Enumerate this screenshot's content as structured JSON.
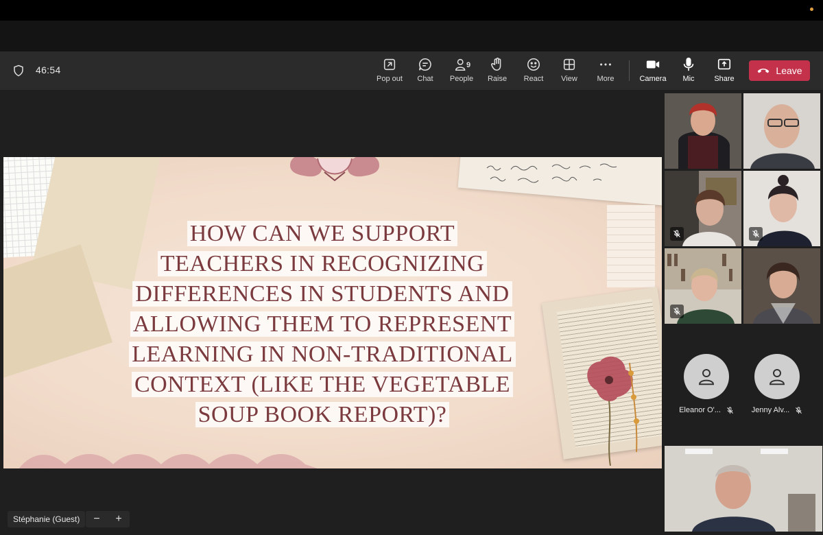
{
  "meeting": {
    "timer": "46:54"
  },
  "toolbar": {
    "popout": "Pop out",
    "chat": "Chat",
    "people": "People",
    "people_count": "9",
    "raise": "Raise",
    "react": "React",
    "view": "View",
    "more": "More",
    "camera": "Camera",
    "mic": "Mic",
    "share": "Share",
    "leave": "Leave"
  },
  "slide": {
    "lines": [
      "HOW CAN WE SUPPORT",
      "TEACHERS IN RECOGNIZING",
      "DIFFERENCES IN STUDENTS AND",
      "ALLOWING THEM TO REPRESENT",
      "LEARNING IN NON-TRADITIONAL",
      "CONTEXT (LIKE THE VEGETABLE",
      "SOUP BOOK REPORT)?"
    ]
  },
  "presenter": {
    "name": "Stéphanie (Guest)"
  },
  "zoom": {
    "minus": "−",
    "plus": "+"
  },
  "participants": {
    "avatars": [
      {
        "name": "Eleanor O'..."
      },
      {
        "name": "Jenny Alv..."
      }
    ]
  },
  "colors": {
    "leave": "#c4314b",
    "slide_text": "#7a3a3e",
    "toolbar_bg": "#2b2b2b"
  }
}
